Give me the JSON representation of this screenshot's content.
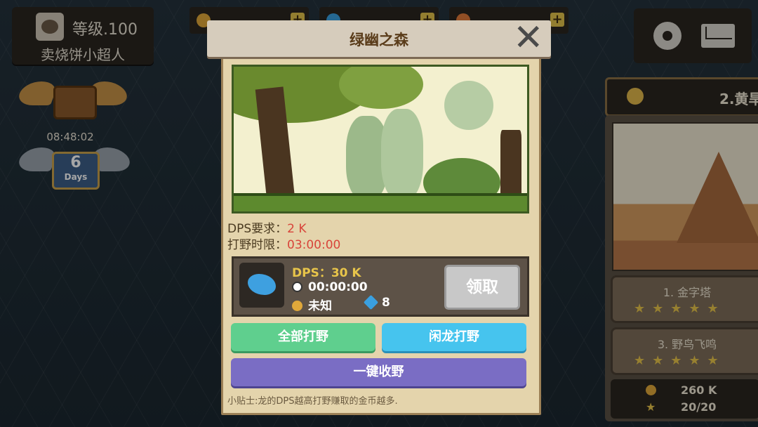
{
  "player": {
    "level": "等级.100",
    "name": "卖烧饼小超人"
  },
  "timer": "08:48:02",
  "badge": {
    "days_number": "6",
    "days_label": "Days"
  },
  "right_panel": {
    "map_title": "2.黄旱",
    "levels": [
      {
        "label": "1. 金字塔",
        "stars": "★★★★★"
      },
      {
        "label": "3. 野鸟飞鸣",
        "stars": "★★★★★"
      }
    ],
    "gold": "260 K",
    "stars_count": "20/20"
  },
  "modal": {
    "title": "绿幽之森",
    "close_glyph": "✕",
    "dps_req_label": "DPS要求：",
    "dps_req_value": "2 K",
    "time_limit_label": "打野时限：",
    "time_limit_value": "03:00:00",
    "dragon": {
      "dps": "DPS：30 K",
      "elapsed": "00:00:00",
      "gold_reward": "未知",
      "gem_reward": "8"
    },
    "claim_button": "领取",
    "all_button": "全部打野",
    "idle_button": "闲龙打野",
    "collect_button": "一键收野",
    "tip": "小贴士:龙的DPS越高打野赚取的金币越多."
  },
  "colors": {
    "accent_red": "#d8443a",
    "dps_gold": "#e8c54a",
    "green": "#5fcf8e",
    "blue": "#46c4ee",
    "purple": "#7a6dc4"
  }
}
